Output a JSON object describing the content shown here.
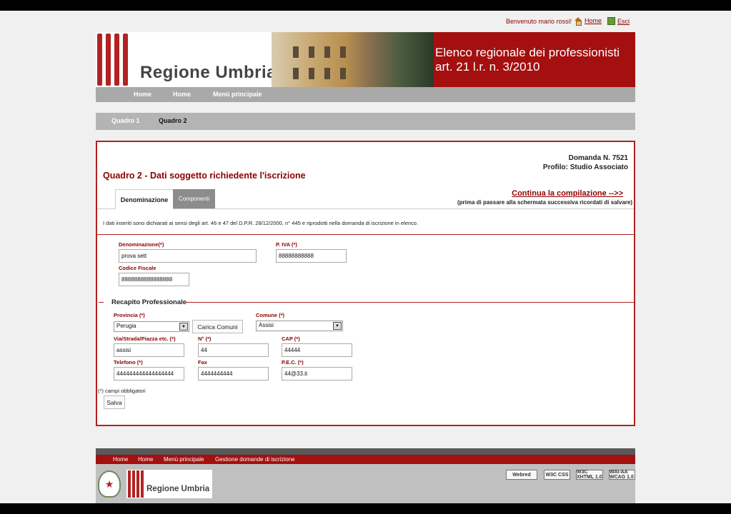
{
  "header": {
    "welcome": "Benvenuto mario rossi!",
    "home_link": "Home",
    "exit_link": "Esci"
  },
  "banner": {
    "region_name": "Regione Umbria",
    "title_line1": "Elenco regionale dei professionisti",
    "title_line2": "art. 21 l.r. n. 3/2010"
  },
  "nav_main": [
    "Home",
    "Home",
    "Menù principale"
  ],
  "nav_quadri": [
    "Quadro 1",
    "Quadro 2"
  ],
  "panel": {
    "domanda": "Domanda N. 7521",
    "profilo": "Profilo: Studio Associato",
    "title": "Quadro 2 - Dati soggetto richiedente l'iscrizione",
    "tabs": [
      "Denominazione",
      "Componenti"
    ],
    "continua": "Continua la compilazione -->>",
    "continua_note": "(prima di passare alla schermata successiva ricordati di salvare)",
    "disclaimer": "I dati inseriti sono dichiarati ai sensi degli art. 46 e 47 del D.P.R. 28/12/2000, n° 445 e riprodotti nella domanda di iscrizione in elenco."
  },
  "form": {
    "denominazione_label": "Denominazione(*)",
    "denominazione_value": "prova sett",
    "piva_label": "P. IVA (*)",
    "piva_value": "88888888888",
    "cf_label": "Codice Fiscale",
    "cf_value": "8888888888888888"
  },
  "recapito": {
    "title": "Recapito Professionale",
    "provincia_label": "Provincia (*)",
    "provincia_value": "Perugia",
    "carica_button": "Carica Comuni",
    "comune_label": "Comune (*)",
    "comune_value": "Assisi",
    "via_label": "Via/Strada/Piazza etc. (*)",
    "via_value": "assisi",
    "numero_label": "N° (*)",
    "numero_value": "44",
    "cap_label": "CAP (*)",
    "cap_value": "44444",
    "telefono_label": "Telefono (*)",
    "telefono_value": "444444444444444444",
    "fax_label": "Fax",
    "fax_value": "4444444444",
    "pec_label": "P.E.C. (*)",
    "pec_value": "44@33.it"
  },
  "required_note": "(*) campi obbligatori",
  "save_button": "Salva",
  "footer": {
    "links": [
      "Home",
      "Home",
      "Menù principale",
      "Gestione domande di iscrizione"
    ],
    "region_name": "Regione Umbria",
    "badges": [
      "Webred",
      "W3C CSS",
      "W3C XHTML 1.0",
      "WAI-AA WCAG 1.0"
    ]
  },
  "colors": {
    "brand_red": "#a40f0f",
    "nav_grey": "#a9a9a9"
  }
}
